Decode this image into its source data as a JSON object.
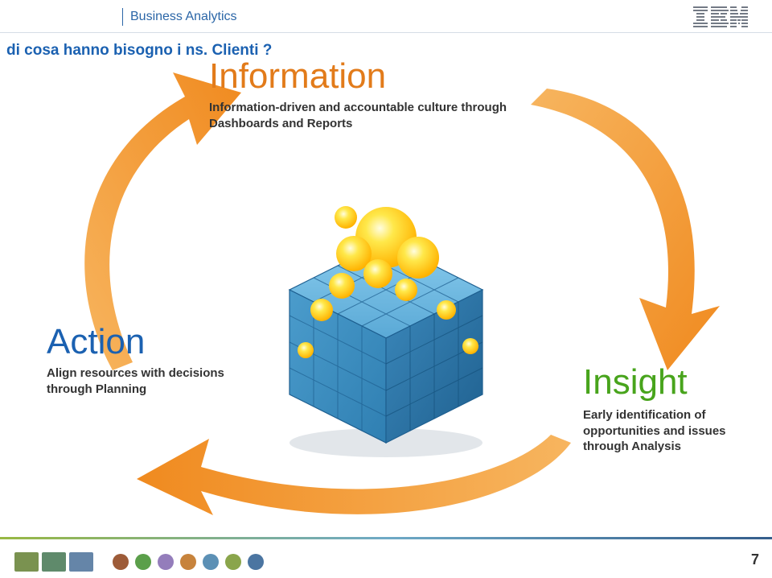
{
  "header": {
    "brand": "Business Analytics",
    "logo_name": "IBM"
  },
  "page_title": "di cosa hanno bisogno i ns. Clienti ?",
  "info": {
    "title": "Information",
    "desc": "Information-driven and accountable culture through Dashboards and Reports"
  },
  "action": {
    "title": "Action",
    "desc": "Align resources with decisions through Planning"
  },
  "insight": {
    "title": "Insight",
    "desc": "Early identification of opportunities and issues through Analysis"
  },
  "footer": {
    "dot_colors": [
      "#9d5b38",
      "#5b9f4a",
      "#947dbb",
      "#c7833c",
      "#5c90b5",
      "#8aa54b",
      "#4b75a1"
    ],
    "thumb_colors": [
      "#7a9250",
      "#5f8a6b",
      "#6585a8"
    ],
    "page_number": "7"
  },
  "colors": {
    "arrow_a": "#f08a1f",
    "arrow_b": "#f7b55f",
    "cube_face_top": "#6fb7e2",
    "cube_face_left": "#3c8fc0",
    "cube_face_right": "#2a6fa0",
    "cube_line": "#1e5f90",
    "glow_a": "#ffe84a",
    "glow_b": "#ffb200"
  }
}
